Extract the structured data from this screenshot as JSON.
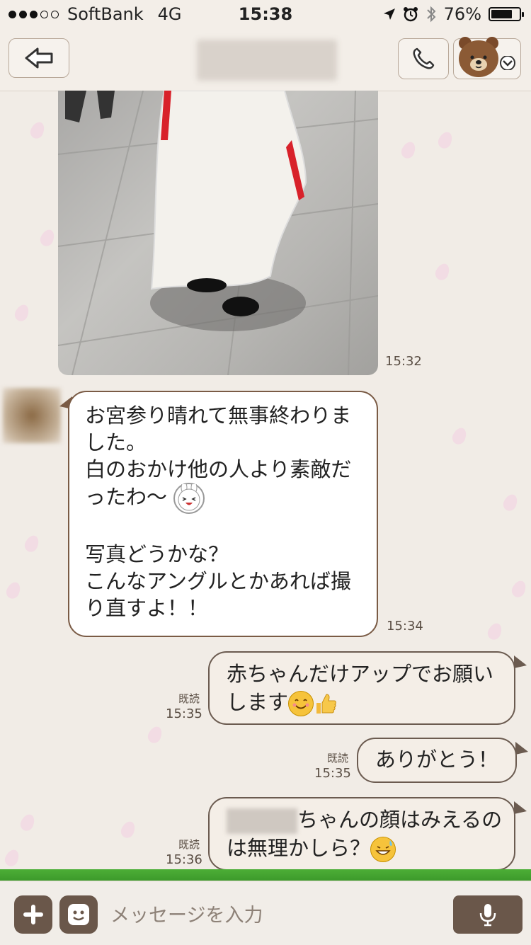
{
  "status_bar": {
    "carrier": "SoftBank",
    "network": "4G",
    "time": "15:38",
    "battery_text": "76%",
    "battery_level": 0.76
  },
  "header": {
    "back_icon": "back-arrow-icon",
    "call_icon": "phone-icon",
    "menu_icon": "chevron-down-icon",
    "avatar": "brown-bear-avatar"
  },
  "messages": [
    {
      "type": "photo",
      "direction": "incoming",
      "time": "15:32"
    },
    {
      "type": "text",
      "direction": "incoming",
      "time": "15:34",
      "lines": [
        "お宮参り晴れて無事終わりま",
        "した。",
        "白のおかけ他の人より素敵だ",
        "ったわ〜",
        "",
        "写真どうかな？",
        "こんなアングルとかあれば撮",
        "り直すよ！！"
      ]
    },
    {
      "type": "text",
      "direction": "outgoing",
      "read": "既読",
      "time": "15:35",
      "lines": [
        "赤ちゃんだけアップでお願い",
        "します"
      ]
    },
    {
      "type": "text",
      "direction": "outgoing",
      "read": "既読",
      "time": "15:35",
      "lines": [
        "ありがとう！"
      ]
    },
    {
      "type": "text",
      "direction": "outgoing",
      "read": "既読",
      "time": "15:36",
      "lines": [
        "ちゃんの顔はみえるの",
        "は無理かしら？"
      ]
    }
  ],
  "input": {
    "placeholder": "メッセージを入力",
    "plus_icon": "plus-icon",
    "sticker_icon": "sticker-face-icon",
    "mic_icon": "microphone-icon"
  },
  "colors": {
    "background": "#f1ece6",
    "bubble_border_in": "#7a5b45",
    "button_brown": "#6a574a",
    "grass": "#4cae36"
  }
}
